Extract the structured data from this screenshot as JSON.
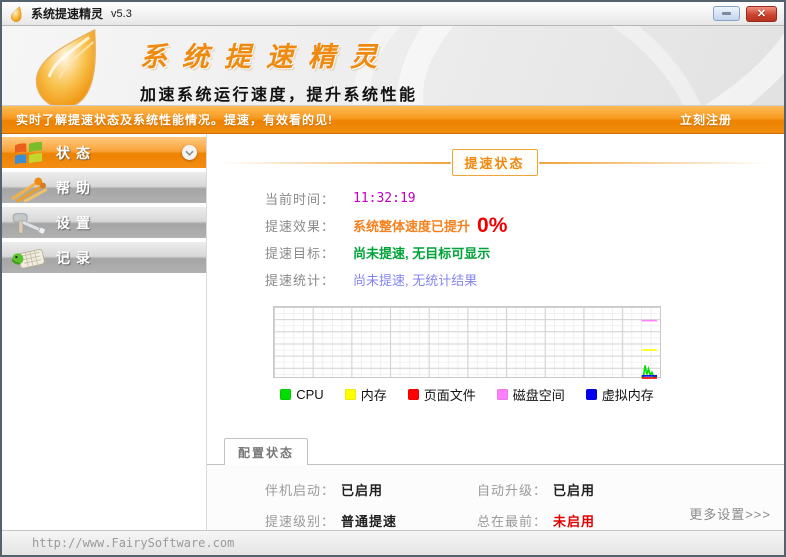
{
  "window": {
    "title": "系统提速精灵",
    "version": "v5.3"
  },
  "banner": {
    "app_name": "系统提速精灵",
    "slogan": "加速系统运行速度，提升系统性能"
  },
  "notice_bar": {
    "message": "实时了解提速状态及系统性能情况。提速，有效看的见!",
    "register_link": "立刻注册"
  },
  "sidebar": {
    "items": [
      {
        "label": "状态",
        "icon": "windows-flag-icon",
        "active": true
      },
      {
        "label": "帮助",
        "icon": "speed-streaks-icon",
        "active": false
      },
      {
        "label": "设置",
        "icon": "tools-icon",
        "active": false
      },
      {
        "label": "记录",
        "icon": "records-icon",
        "active": false
      }
    ]
  },
  "status_section": {
    "header": "提速状态",
    "rows": [
      {
        "label": "当前时间：",
        "value": "11:32:19"
      },
      {
        "label": "提速效果：",
        "value": "系统整体速度已提升",
        "percent": "0%"
      },
      {
        "label": "提速目标：",
        "value": "尚未提速, 无目标可显示"
      },
      {
        "label": "提速统计：",
        "value": "尚未提速, 无统计结果"
      }
    ]
  },
  "chart_data": {
    "type": "line",
    "title": "",
    "xlabel": "",
    "ylabel": "",
    "ylim": [
      0,
      100
    ],
    "grid": true,
    "legend_position": "bottom",
    "note": "real-time monitor just started; only most recent samples at right edge",
    "series": [
      {
        "name": "CPU",
        "color": "#00dd00",
        "values": [
          1,
          2,
          18,
          5,
          13,
          4,
          8,
          2,
          1,
          3
        ]
      },
      {
        "name": "内存",
        "color": "#ffff00",
        "values": [
          40,
          40,
          40,
          40,
          40,
          40,
          40,
          40,
          40,
          40
        ]
      },
      {
        "name": "页面文件",
        "color": "#ff0000",
        "values": [
          0,
          0,
          0,
          0,
          0,
          0,
          0,
          0,
          0,
          0
        ]
      },
      {
        "name": "磁盘空间",
        "color": "#ff80ff",
        "values": [
          82,
          82,
          82,
          82,
          82,
          82,
          82,
          82,
          82,
          82
        ]
      },
      {
        "name": "虚拟内存",
        "color": "#0000ee",
        "values": [
          3,
          3,
          3,
          3,
          3,
          3,
          3,
          3,
          3,
          3
        ]
      }
    ]
  },
  "config_section": {
    "tab": "配置状态",
    "items": [
      {
        "label": "伴机启动：",
        "value": "已启用",
        "highlight": false
      },
      {
        "label": "自动升级：",
        "value": "已启用",
        "highlight": false
      },
      {
        "label": "提速级别：",
        "value": "普通提速",
        "highlight": false
      },
      {
        "label": "总在最前：",
        "value": "未启用",
        "highlight": true
      }
    ],
    "more_link": "更多设置>>>"
  },
  "status_bar": {
    "url": "http://www.FairySoftware.com"
  },
  "colors": {
    "accent_orange": "#ee8200",
    "time_value": "#c000c8",
    "effect_text": "#f58220",
    "percent_value": "#f00000",
    "target_text": "#00a33a",
    "stats_text": "#8585f0",
    "alert_red": "#e00000"
  }
}
